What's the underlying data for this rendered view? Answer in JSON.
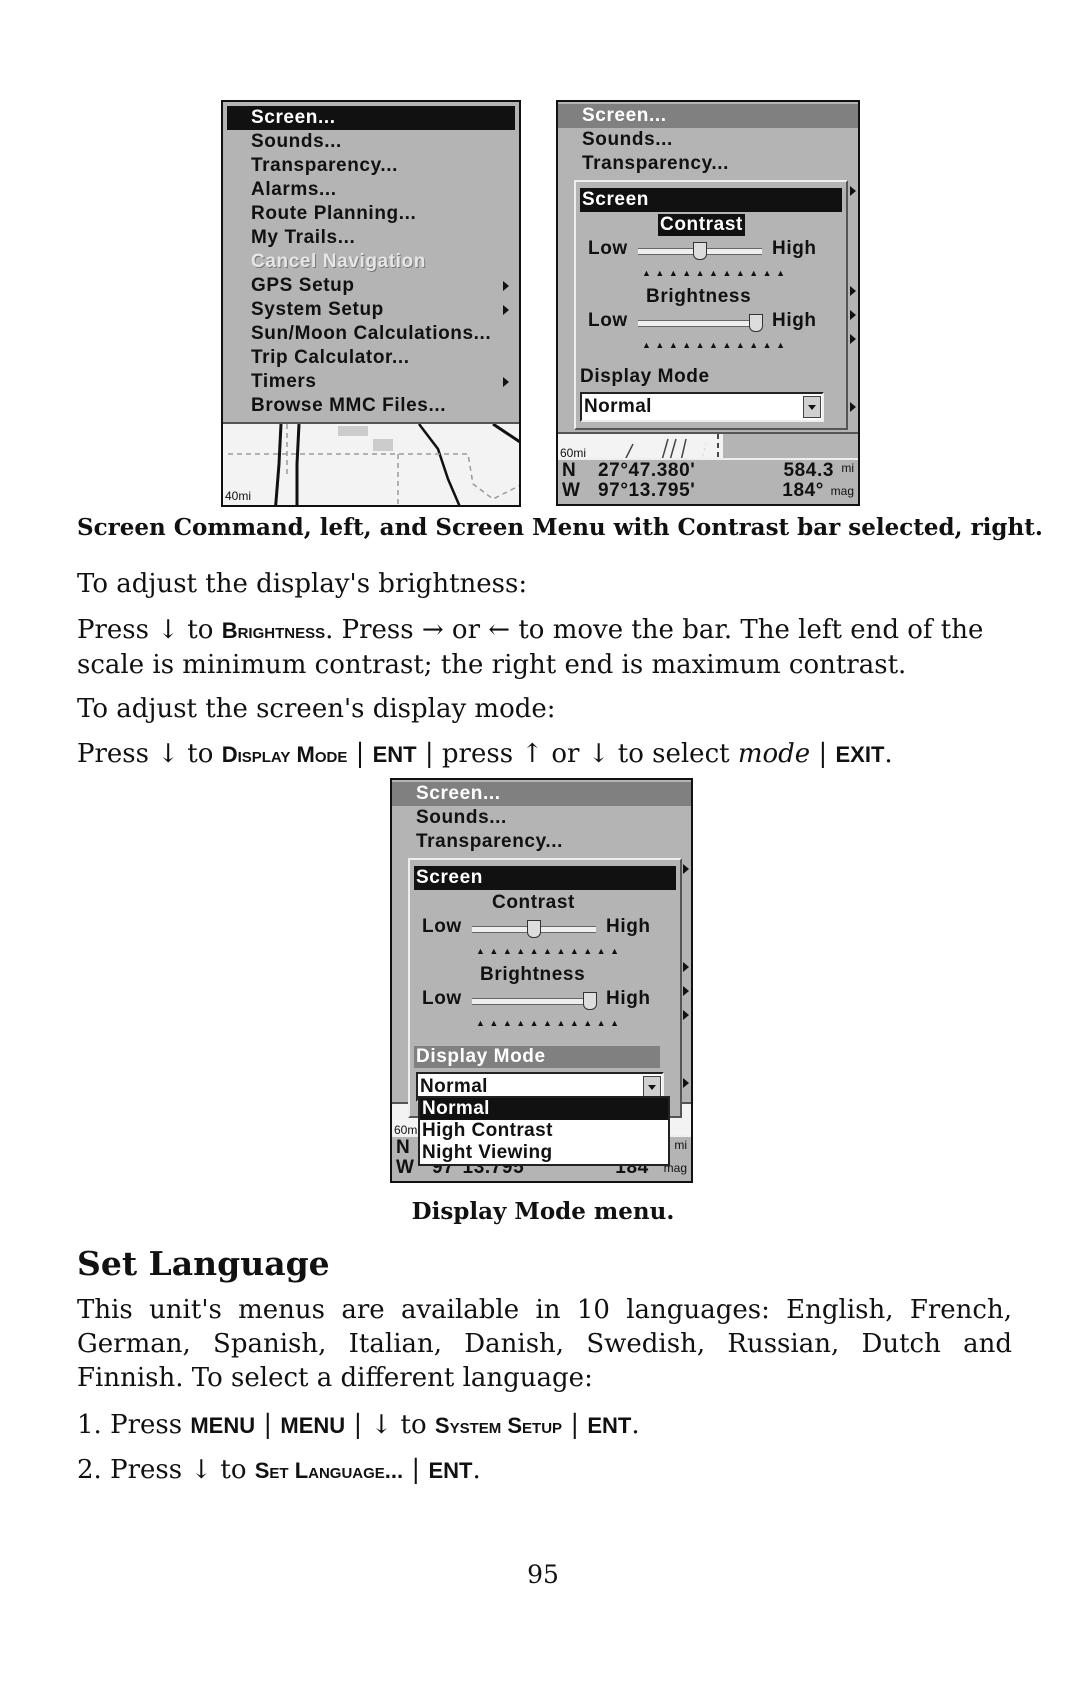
{
  "left_screen": {
    "menu_items": [
      {
        "label": "Screen...",
        "state": "selected",
        "submenu": false
      },
      {
        "label": "Sounds...",
        "state": "normal",
        "submenu": false
      },
      {
        "label": "Transparency...",
        "state": "normal",
        "submenu": false
      },
      {
        "label": "Alarms...",
        "state": "normal",
        "submenu": false
      },
      {
        "label": "Route Planning...",
        "state": "normal",
        "submenu": false
      },
      {
        "label": "My Trails...",
        "state": "normal",
        "submenu": false
      },
      {
        "label": "Cancel Navigation",
        "state": "disabled",
        "submenu": false
      },
      {
        "label": "GPS Setup",
        "state": "normal",
        "submenu": true
      },
      {
        "label": "System Setup",
        "state": "normal",
        "submenu": true
      },
      {
        "label": "Sun/Moon Calculations...",
        "state": "normal",
        "submenu": false
      },
      {
        "label": "Trip Calculator...",
        "state": "normal",
        "submenu": false
      },
      {
        "label": "Timers",
        "state": "normal",
        "submenu": true
      },
      {
        "label": "Browse MMC Files...",
        "state": "normal",
        "submenu": false
      }
    ],
    "map_scale": "40mi"
  },
  "right_screen": {
    "menu_items": [
      "Screen...",
      "Sounds...",
      "Transparency..."
    ],
    "dialog_title": "Screen",
    "contrast_label": "Contrast",
    "brightness_label": "Brightness",
    "low_label": "Low",
    "high_label": "High",
    "contrast_value": 0.5,
    "brightness_value": 0.95,
    "display_mode_label": "Display Mode",
    "display_mode_value": "Normal",
    "map_scale": "60mi",
    "status": {
      "lat_dir": "N",
      "lat": "27°47.380'",
      "distance": "584.3",
      "distance_unit": "mi",
      "lon_dir": "W",
      "lon": "97°13.795'",
      "bearing": "184°",
      "bearing_unit": "mag"
    }
  },
  "center_screen": {
    "menu_items": [
      "Screen...",
      "Sounds...",
      "Transparency..."
    ],
    "dialog_title": "Screen",
    "contrast_label": "Contrast",
    "brightness_label": "Brightness",
    "low_label": "Low",
    "high_label": "High",
    "contrast_value": 0.5,
    "brightness_value": 0.95,
    "display_mode_label": "Display Mode",
    "display_mode_value": "Normal",
    "dropdown_options": [
      "Normal",
      "High Contrast",
      "Night Viewing"
    ],
    "dropdown_selected": "Normal",
    "map_scale": "60mi",
    "status": {
      "lat_dir": "N",
      "distance_unit": "mi",
      "lon_dir": "W",
      "lon": "97°13.795'",
      "bearing": "184°",
      "bearing_unit": "mag"
    }
  },
  "text": {
    "caption1": "Screen Command, left, and Screen Menu with Contrast bar selected, right.",
    "p1": "To adjust the display's brightness:",
    "p2_a": "Press ↓ to ",
    "p2_key": "Brightness",
    "p2_b": ". Press → or ← to move the bar. The left end of the scale is minimum contrast; the right end is maximum contrast.",
    "p3": "To adjust the screen's display mode:",
    "p4_a": "Press ↓ to ",
    "p4_key1": "Display Mode",
    "p4_sep1": " | ",
    "p4_key2": "ENT",
    "p4_b": " | press ↑ or ↓ to select ",
    "p4_em": "mode",
    "p4_sep2": " | ",
    "p4_key3": "EXIT",
    "p4_end": ".",
    "caption2": "Display Mode menu.",
    "heading": "Set Language",
    "p5": "This unit's menus are available in 10 languages: English, French, German, Spanish, Italian, Danish, Swedish, Russian, Dutch and Finnish. To select a different language:",
    "step1_a": "1. Press ",
    "step1_k1": "MENU",
    "step1_sep": " | ",
    "step1_k2": "MENU",
    "step1_b": " | ↓ to ",
    "step1_k3": "System Setup",
    "step1_sep2": " | ",
    "step1_k4": "ENT",
    "step1_end": ".",
    "step2_a": "2. Press ↓ to ",
    "step2_k1": "Set Language...",
    "step2_sep": " | ",
    "step2_k2": "ENT",
    "step2_end": ".",
    "page_number": "95"
  }
}
